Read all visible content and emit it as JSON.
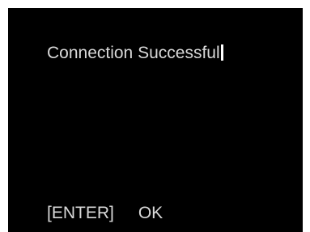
{
  "dialog": {
    "message": "Connection Successful",
    "key_hint": "[ENTER]",
    "action_label": "OK"
  },
  "colors": {
    "screen_background": "#000000",
    "text": "#d9d9d9",
    "cursor": "#ffffff"
  }
}
